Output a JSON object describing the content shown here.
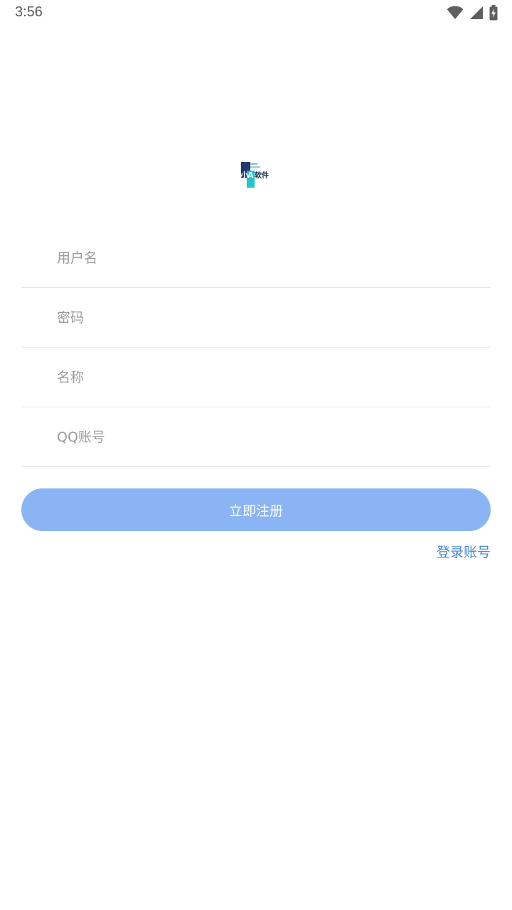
{
  "status_bar": {
    "time": "3:56",
    "icons": [
      "wifi-icon",
      "cellular-signal-icon",
      "battery-charging-icon"
    ]
  },
  "logo": {
    "text": "小A软件",
    "icon": "app-logo"
  },
  "form": {
    "username_placeholder": "用户名",
    "password_placeholder": "密码",
    "name_placeholder": "名称",
    "qq_placeholder": "QQ账号",
    "username_value": "",
    "password_value": "",
    "name_value": "",
    "qq_value": ""
  },
  "actions": {
    "register_label": "立即注册",
    "login_label": "登录账号"
  },
  "colors": {
    "button_bg": "#8bb4f4",
    "link": "#4a86d8",
    "divider": "#e6e6e6",
    "placeholder": "#9a9a9a"
  }
}
